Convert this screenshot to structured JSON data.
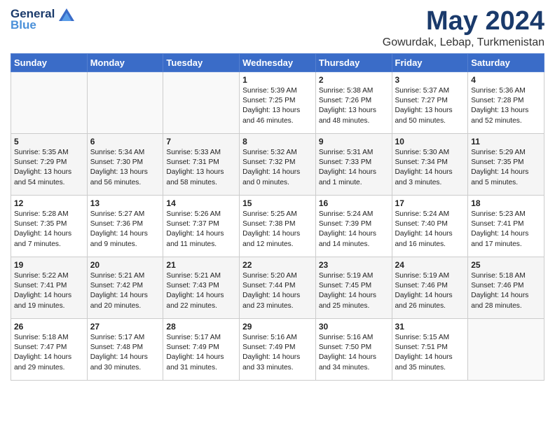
{
  "header": {
    "logo_line1": "General",
    "logo_line2": "Blue",
    "title": "May 2024",
    "subtitle": "Gowurdak, Lebap, Turkmenistan"
  },
  "days_of_week": [
    "Sunday",
    "Monday",
    "Tuesday",
    "Wednesday",
    "Thursday",
    "Friday",
    "Saturday"
  ],
  "weeks": [
    [
      {
        "day": "",
        "sunrise": "",
        "sunset": "",
        "daylight": ""
      },
      {
        "day": "",
        "sunrise": "",
        "sunset": "",
        "daylight": ""
      },
      {
        "day": "",
        "sunrise": "",
        "sunset": "",
        "daylight": ""
      },
      {
        "day": "1",
        "sunrise": "Sunrise: 5:39 AM",
        "sunset": "Sunset: 7:25 PM",
        "daylight": "Daylight: 13 hours and 46 minutes."
      },
      {
        "day": "2",
        "sunrise": "Sunrise: 5:38 AM",
        "sunset": "Sunset: 7:26 PM",
        "daylight": "Daylight: 13 hours and 48 minutes."
      },
      {
        "day": "3",
        "sunrise": "Sunrise: 5:37 AM",
        "sunset": "Sunset: 7:27 PM",
        "daylight": "Daylight: 13 hours and 50 minutes."
      },
      {
        "day": "4",
        "sunrise": "Sunrise: 5:36 AM",
        "sunset": "Sunset: 7:28 PM",
        "daylight": "Daylight: 13 hours and 52 minutes."
      }
    ],
    [
      {
        "day": "5",
        "sunrise": "Sunrise: 5:35 AM",
        "sunset": "Sunset: 7:29 PM",
        "daylight": "Daylight: 13 hours and 54 minutes."
      },
      {
        "day": "6",
        "sunrise": "Sunrise: 5:34 AM",
        "sunset": "Sunset: 7:30 PM",
        "daylight": "Daylight: 13 hours and 56 minutes."
      },
      {
        "day": "7",
        "sunrise": "Sunrise: 5:33 AM",
        "sunset": "Sunset: 7:31 PM",
        "daylight": "Daylight: 13 hours and 58 minutes."
      },
      {
        "day": "8",
        "sunrise": "Sunrise: 5:32 AM",
        "sunset": "Sunset: 7:32 PM",
        "daylight": "Daylight: 14 hours and 0 minutes."
      },
      {
        "day": "9",
        "sunrise": "Sunrise: 5:31 AM",
        "sunset": "Sunset: 7:33 PM",
        "daylight": "Daylight: 14 hours and 1 minute."
      },
      {
        "day": "10",
        "sunrise": "Sunrise: 5:30 AM",
        "sunset": "Sunset: 7:34 PM",
        "daylight": "Daylight: 14 hours and 3 minutes."
      },
      {
        "day": "11",
        "sunrise": "Sunrise: 5:29 AM",
        "sunset": "Sunset: 7:35 PM",
        "daylight": "Daylight: 14 hours and 5 minutes."
      }
    ],
    [
      {
        "day": "12",
        "sunrise": "Sunrise: 5:28 AM",
        "sunset": "Sunset: 7:35 PM",
        "daylight": "Daylight: 14 hours and 7 minutes."
      },
      {
        "day": "13",
        "sunrise": "Sunrise: 5:27 AM",
        "sunset": "Sunset: 7:36 PM",
        "daylight": "Daylight: 14 hours and 9 minutes."
      },
      {
        "day": "14",
        "sunrise": "Sunrise: 5:26 AM",
        "sunset": "Sunset: 7:37 PM",
        "daylight": "Daylight: 14 hours and 11 minutes."
      },
      {
        "day": "15",
        "sunrise": "Sunrise: 5:25 AM",
        "sunset": "Sunset: 7:38 PM",
        "daylight": "Daylight: 14 hours and 12 minutes."
      },
      {
        "day": "16",
        "sunrise": "Sunrise: 5:24 AM",
        "sunset": "Sunset: 7:39 PM",
        "daylight": "Daylight: 14 hours and 14 minutes."
      },
      {
        "day": "17",
        "sunrise": "Sunrise: 5:24 AM",
        "sunset": "Sunset: 7:40 PM",
        "daylight": "Daylight: 14 hours and 16 minutes."
      },
      {
        "day": "18",
        "sunrise": "Sunrise: 5:23 AM",
        "sunset": "Sunset: 7:41 PM",
        "daylight": "Daylight: 14 hours and 17 minutes."
      }
    ],
    [
      {
        "day": "19",
        "sunrise": "Sunrise: 5:22 AM",
        "sunset": "Sunset: 7:41 PM",
        "daylight": "Daylight: 14 hours and 19 minutes."
      },
      {
        "day": "20",
        "sunrise": "Sunrise: 5:21 AM",
        "sunset": "Sunset: 7:42 PM",
        "daylight": "Daylight: 14 hours and 20 minutes."
      },
      {
        "day": "21",
        "sunrise": "Sunrise: 5:21 AM",
        "sunset": "Sunset: 7:43 PM",
        "daylight": "Daylight: 14 hours and 22 minutes."
      },
      {
        "day": "22",
        "sunrise": "Sunrise: 5:20 AM",
        "sunset": "Sunset: 7:44 PM",
        "daylight": "Daylight: 14 hours and 23 minutes."
      },
      {
        "day": "23",
        "sunrise": "Sunrise: 5:19 AM",
        "sunset": "Sunset: 7:45 PM",
        "daylight": "Daylight: 14 hours and 25 minutes."
      },
      {
        "day": "24",
        "sunrise": "Sunrise: 5:19 AM",
        "sunset": "Sunset: 7:46 PM",
        "daylight": "Daylight: 14 hours and 26 minutes."
      },
      {
        "day": "25",
        "sunrise": "Sunrise: 5:18 AM",
        "sunset": "Sunset: 7:46 PM",
        "daylight": "Daylight: 14 hours and 28 minutes."
      }
    ],
    [
      {
        "day": "26",
        "sunrise": "Sunrise: 5:18 AM",
        "sunset": "Sunset: 7:47 PM",
        "daylight": "Daylight: 14 hours and 29 minutes."
      },
      {
        "day": "27",
        "sunrise": "Sunrise: 5:17 AM",
        "sunset": "Sunset: 7:48 PM",
        "daylight": "Daylight: 14 hours and 30 minutes."
      },
      {
        "day": "28",
        "sunrise": "Sunrise: 5:17 AM",
        "sunset": "Sunset: 7:49 PM",
        "daylight": "Daylight: 14 hours and 31 minutes."
      },
      {
        "day": "29",
        "sunrise": "Sunrise: 5:16 AM",
        "sunset": "Sunset: 7:49 PM",
        "daylight": "Daylight: 14 hours and 33 minutes."
      },
      {
        "day": "30",
        "sunrise": "Sunrise: 5:16 AM",
        "sunset": "Sunset: 7:50 PM",
        "daylight": "Daylight: 14 hours and 34 minutes."
      },
      {
        "day": "31",
        "sunrise": "Sunrise: 5:15 AM",
        "sunset": "Sunset: 7:51 PM",
        "daylight": "Daylight: 14 hours and 35 minutes."
      },
      {
        "day": "",
        "sunrise": "",
        "sunset": "",
        "daylight": ""
      }
    ]
  ]
}
